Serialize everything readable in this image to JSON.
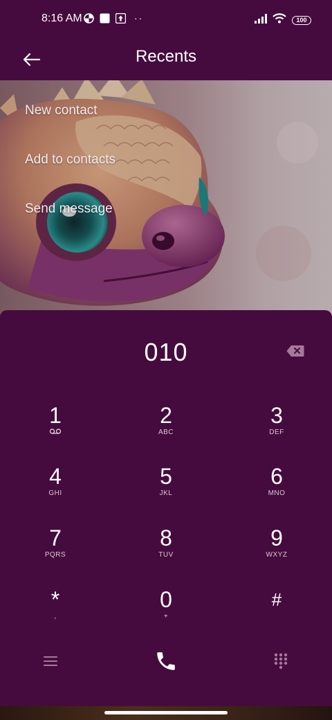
{
  "status_bar": {
    "time": "8:16 AM",
    "battery": "100",
    "left_icons": [
      "vpn-icon",
      "square-notification-icon",
      "upload-icon"
    ],
    "more_dots": "··",
    "right_icons": [
      "signal-icon",
      "wifi-icon",
      "battery-icon"
    ]
  },
  "app_bar": {
    "title": "Recents",
    "back_icon": "back-arrow-icon"
  },
  "menu": {
    "items": [
      {
        "label": "New contact"
      },
      {
        "label": "Add to contacts"
      },
      {
        "label": "Send message"
      }
    ]
  },
  "dialer": {
    "number": "010",
    "keys": [
      {
        "digit": "1",
        "sub": "",
        "sub_icon": "voicemail-icon"
      },
      {
        "digit": "2",
        "sub": "ABC"
      },
      {
        "digit": "3",
        "sub": "DEF"
      },
      {
        "digit": "4",
        "sub": "GHI"
      },
      {
        "digit": "5",
        "sub": "JKL"
      },
      {
        "digit": "6",
        "sub": "MNO"
      },
      {
        "digit": "7",
        "sub": "PQRS"
      },
      {
        "digit": "8",
        "sub": "TUV"
      },
      {
        "digit": "9",
        "sub": "WXYZ"
      },
      {
        "digit": "*",
        "sub": ","
      },
      {
        "digit": "0",
        "sub": "+"
      },
      {
        "digit": "#",
        "sub": ""
      }
    ],
    "bottom_icons": [
      "menu-icon",
      "call-icon",
      "keypad-icon"
    ]
  },
  "colors": {
    "background": "#460b3e",
    "text": "#ffffff",
    "secondary_text": "#d9c8d5",
    "icon_muted": "#a47a9c"
  }
}
